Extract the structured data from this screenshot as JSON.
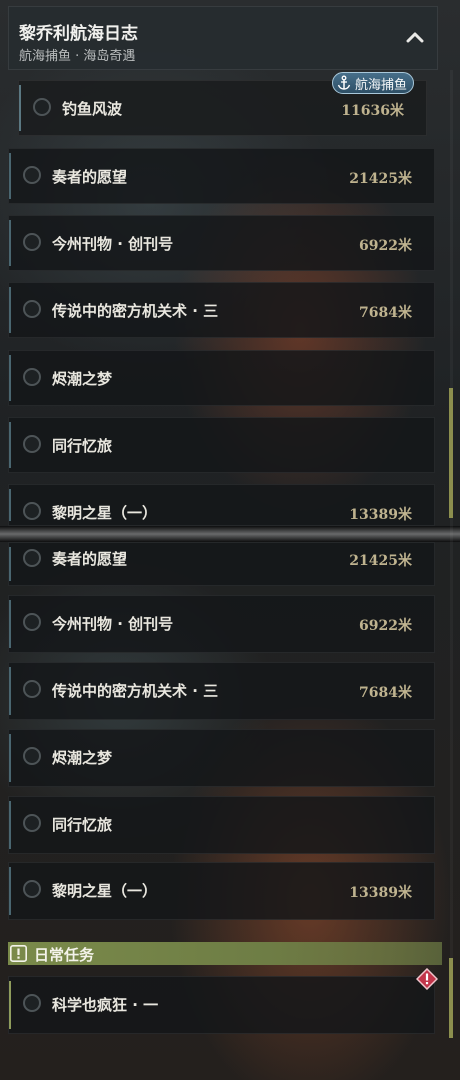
{
  "header": {
    "title": "黎乔利航海日志",
    "subtitle": "航海捕鱼 · 海岛奇遇"
  },
  "badge": {
    "label": "航海捕鱼",
    "icon": "anchor-icon"
  },
  "upper_quests": [
    {
      "name": "钓鱼风波",
      "distance": "11636米"
    },
    {
      "name": "奏者的愿望",
      "distance": "21425米"
    },
    {
      "name": "今州刊物 · 创刊号",
      "distance": "6922米"
    },
    {
      "name": "传说中的密方机关术 · 三",
      "distance": "7684米"
    },
    {
      "name": "烬潮之梦",
      "distance": ""
    },
    {
      "name": "同行忆旅",
      "distance": ""
    },
    {
      "name": "黎明之星（一）",
      "distance": "13389米"
    }
  ],
  "lower_quests": [
    {
      "name": "奏者的愿望",
      "distance": "21425米"
    },
    {
      "name": "今州刊物 · 创刊号",
      "distance": "6922米"
    },
    {
      "name": "传说中的密方机关术 · 三",
      "distance": "7684米"
    },
    {
      "name": "烬潮之梦",
      "distance": ""
    },
    {
      "name": "同行忆旅",
      "distance": ""
    },
    {
      "name": "黎明之星（一）",
      "distance": "13389米"
    }
  ],
  "daily": {
    "header": "日常任务",
    "quests": [
      {
        "name": "科学也疯狂 · 一",
        "distance": ""
      }
    ]
  },
  "colors": {
    "distance": "#bfb38f",
    "daily_accent": "#7a8a4a",
    "badge": "#3a617b",
    "alert": "#c2354a"
  }
}
